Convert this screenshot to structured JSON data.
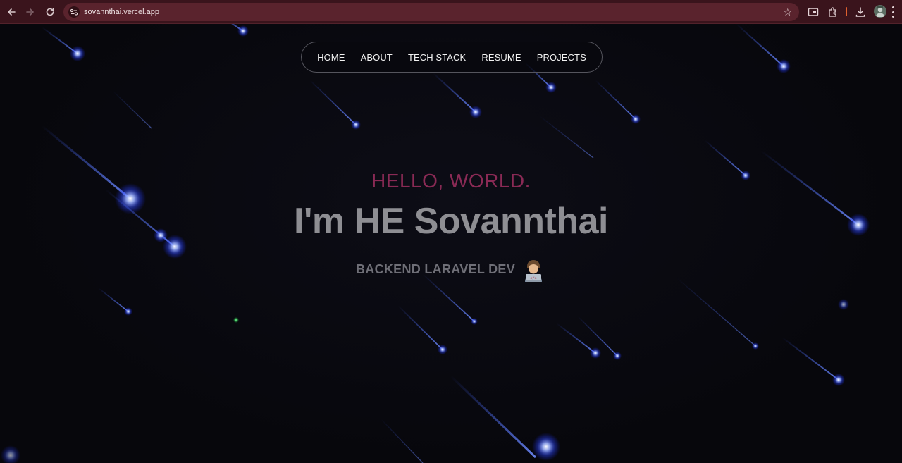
{
  "browser": {
    "url": "sovannthai.vercel.app",
    "icons": [
      "back-icon",
      "forward-icon",
      "reload-icon",
      "site-info-icon",
      "bookmark-star-icon",
      "cast-icon",
      "extensions-icon",
      "download-icon",
      "profile-avatar",
      "menu-icon"
    ],
    "colors": {
      "frame": "#3a141c",
      "omnibox": "#5a232d"
    }
  },
  "nav": {
    "items": [
      {
        "label": "HOME"
      },
      {
        "label": "ABOUT"
      },
      {
        "label": "TECH STACK"
      },
      {
        "label": "RESUME"
      },
      {
        "label": "PROJECTS"
      }
    ]
  },
  "hero": {
    "greeting": "HELLO, WORLD.",
    "name": "I'm HE Sovannthai",
    "role": "BACKEND LARAVEL DEV",
    "role_icon": "developer-emoji-icon"
  },
  "colors": {
    "background": "#07070c",
    "greeting": "#8a2a55",
    "name": "#8e8e93",
    "role": "#6f6f77",
    "meteor": "#4a6cff"
  }
}
